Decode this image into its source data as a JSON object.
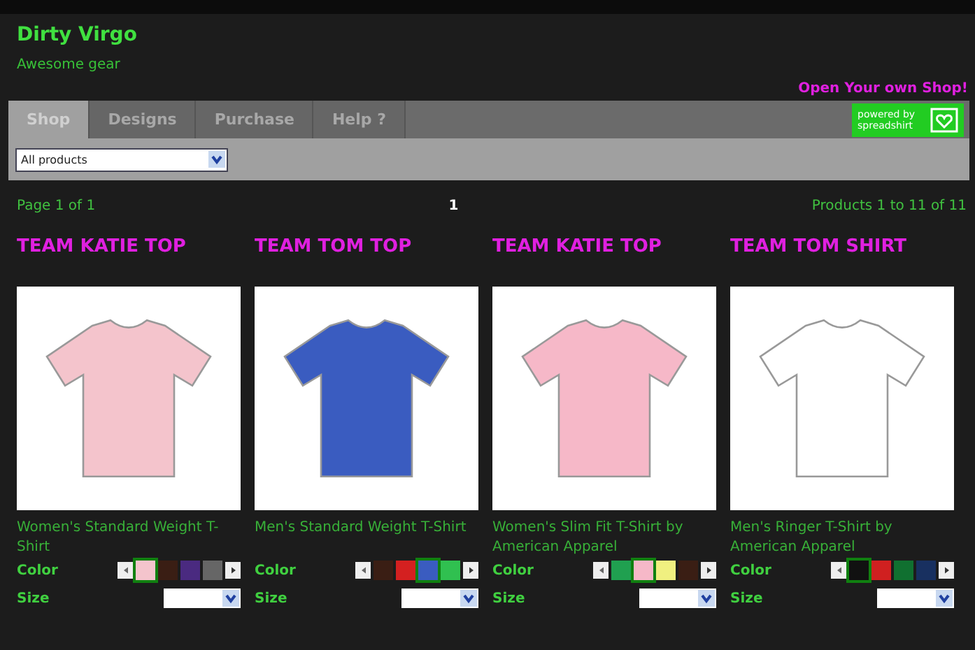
{
  "shop": {
    "title": "Dirty Virgo",
    "tagline": "Awesome gear",
    "open_shop_link": "Open Your own Shop!"
  },
  "tabs": [
    {
      "label": "Shop",
      "selected": true
    },
    {
      "label": "Designs",
      "selected": false
    },
    {
      "label": "Purchase",
      "selected": false
    },
    {
      "label": "Help ?",
      "selected": false
    }
  ],
  "powered_by": "powered by spreadshirt",
  "filter": {
    "value": "All products"
  },
  "pagination": {
    "page_info": "Page 1 of 1",
    "current_page": "1",
    "range": "Products 1 to 11 of 11"
  },
  "products": [
    {
      "title": "TEAM KATIE TOP",
      "name": "Women's Standard Weight T-Shirt",
      "color": "#f4c4cc",
      "color_label": "Color",
      "size_label": "Size",
      "swatches": [
        {
          "color": "#f4c4cc",
          "selected": true
        },
        {
          "color": "#3a1e14",
          "selected": false
        },
        {
          "color": "#4a2a80",
          "selected": false
        },
        {
          "color": "#666666",
          "selected": false
        }
      ]
    },
    {
      "title": "TEAM TOM TOP",
      "name": "Men's Standard Weight T-Shirt",
      "color": "#3a5cc0",
      "color_label": "Color",
      "size_label": "Size",
      "swatches": [
        {
          "color": "#3a1e14",
          "selected": false
        },
        {
          "color": "#d42020",
          "selected": false
        },
        {
          "color": "#3a5cc0",
          "selected": true
        },
        {
          "color": "#30c050",
          "selected": false
        }
      ]
    },
    {
      "title": "TEAM KATIE TOP",
      "name": "Women's Slim Fit T-Shirt by American Apparel",
      "color": "#f6b8c8",
      "color_label": "Color",
      "size_label": "Size",
      "swatches": [
        {
          "color": "#20a050",
          "selected": false
        },
        {
          "color": "#f6b8c8",
          "selected": true
        },
        {
          "color": "#f0f080",
          "selected": false
        },
        {
          "color": "#3a1e14",
          "selected": false
        }
      ]
    },
    {
      "title": "TEAM TOM SHIRT",
      "name": "Men's Ringer T-Shirt by American Apparel",
      "color": "#ffffff",
      "color_label": "Color",
      "size_label": "Size",
      "swatches": [
        {
          "color": "#111111",
          "selected": true
        },
        {
          "color": "#d02020",
          "selected": false
        },
        {
          "color": "#107030",
          "selected": false
        },
        {
          "color": "#183060",
          "selected": false
        }
      ]
    }
  ]
}
